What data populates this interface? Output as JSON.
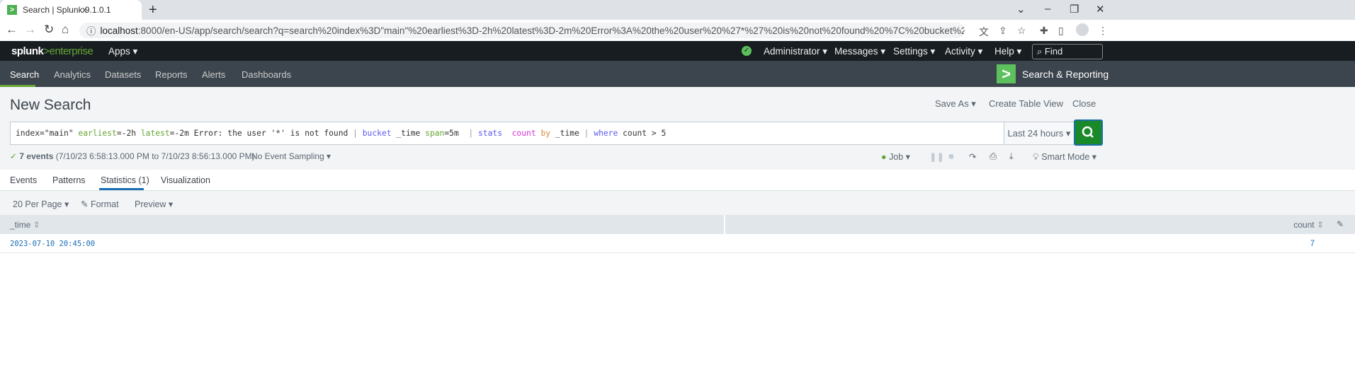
{
  "browser": {
    "tab_title": "Search | Splunk 9.1.0.1",
    "tab_close": "x",
    "new_tab": "+",
    "url_host": "localhost",
    "url_rest": ":8000/en-US/app/search/search?q=search%20index%3D\"main\"%20earliest%3D-2h%20latest%3D-2m%20Error%3A%20the%20user%20%27*%27%20is%20not%20found%20%7C%20bucket%20_time%20span%3D5m%20%20%7C%20..."
  },
  "topbar": {
    "logo_a": "splunk",
    "logo_b": ">enterprise",
    "apps": "Apps ▾",
    "user": "Administrator ▾",
    "messages": "Messages ▾",
    "settings": "Settings ▾",
    "activity": "Activity ▾",
    "help": "Help ▾",
    "find": "Find"
  },
  "appbar": {
    "tabs": [
      "Search",
      "Analytics",
      "Datasets",
      "Reports",
      "Alerts",
      "Dashboards"
    ],
    "app_name": "Search & Reporting"
  },
  "header": {
    "title": "New Search",
    "save_as": "Save As ▾",
    "create_table": "Create Table View",
    "close": "Close"
  },
  "search": {
    "tokens": [
      {
        "t": "index=\"main\" ",
        "c": ""
      },
      {
        "t": "earliest",
        "c": "green"
      },
      {
        "t": "=-2h ",
        "c": ""
      },
      {
        "t": "latest",
        "c": "green"
      },
      {
        "t": "=-2m Error: the user '*' is not found ",
        "c": ""
      },
      {
        "t": "| ",
        "c": "grey"
      },
      {
        "t": "bucket",
        "c": "blue"
      },
      {
        "t": " _time ",
        "c": ""
      },
      {
        "t": "span",
        "c": "green"
      },
      {
        "t": "=5m  ",
        "c": ""
      },
      {
        "t": "| ",
        "c": "grey"
      },
      {
        "t": "stats",
        "c": "blue"
      },
      {
        "t": "  ",
        "c": ""
      },
      {
        "t": "count",
        "c": "pink"
      },
      {
        "t": " ",
        "c": ""
      },
      {
        "t": "by",
        "c": "orange"
      },
      {
        "t": " _time ",
        "c": ""
      },
      {
        "t": "| ",
        "c": "grey"
      },
      {
        "t": "where",
        "c": "blue"
      },
      {
        "t": " count > 5",
        "c": ""
      }
    ],
    "time_range": "Last 24 hours ▾"
  },
  "status": {
    "events": "7 events",
    "range": "(7/10/23 6:58:13.000 PM to 7/10/23 8:56:13.000 PM)",
    "sampling": "No Event Sampling ▾",
    "job": "Job ▾",
    "mode": "Smart Mode ▾"
  },
  "result_tabs": [
    "Events",
    "Patterns",
    "Statistics (1)",
    "Visualization"
  ],
  "toolbar": {
    "per_page": "20 Per Page ▾",
    "format": "Format",
    "preview": "Preview ▾"
  },
  "table": {
    "columns": [
      "_time",
      "count"
    ],
    "rows": [
      [
        "2023-07-10 20:45:00",
        "7"
      ]
    ]
  },
  "colors": {
    "accent": "#65a637",
    "search_button": "#1a8929",
    "link": "#1a6fb5"
  }
}
